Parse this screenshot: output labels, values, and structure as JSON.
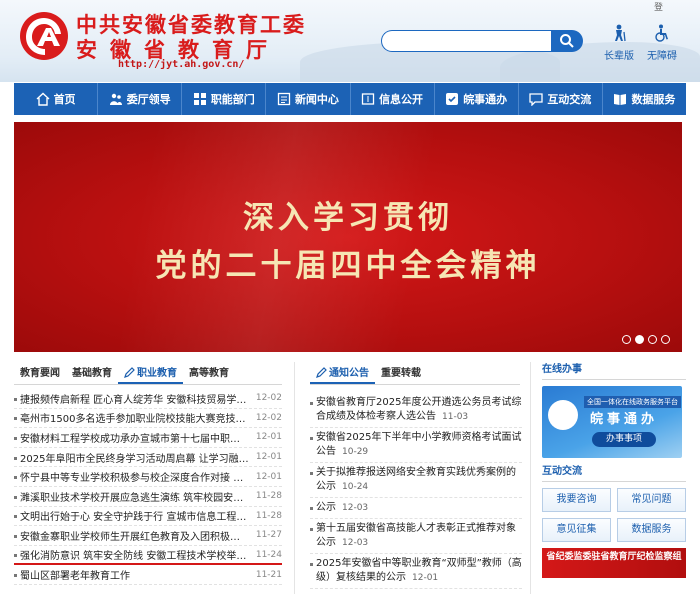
{
  "header": {
    "title_line1": "中共安徽省委教育工委",
    "title_line2": "安徽省教育厅",
    "url": "http://jyt.ah.gov.cn/",
    "search": {
      "value": "",
      "placeholder": ""
    },
    "accessibility": [
      {
        "label": "长辈版",
        "icon": "elder-person-icon"
      },
      {
        "label": "无障碍",
        "icon": "wheelchair-icon"
      }
    ],
    "top_strip_text": "登"
  },
  "nav": {
    "items": [
      {
        "label": "首页",
        "icon": "home-icon"
      },
      {
        "label": "委厅领导",
        "icon": "leader-icon"
      },
      {
        "label": "职能部门",
        "icon": "department-icon"
      },
      {
        "label": "新闻中心",
        "icon": "news-icon"
      },
      {
        "label": "信息公开",
        "icon": "info-icon"
      },
      {
        "label": "皖事通办",
        "icon": "service-icon"
      },
      {
        "label": "互动交流",
        "icon": "chat-icon"
      },
      {
        "label": "数据服务",
        "icon": "book-icon"
      }
    ]
  },
  "banner": {
    "line1": "深入学习贯彻",
    "line2": "党的二十届四中全会精神",
    "slides": 4,
    "active_slide": 2,
    "colors": {
      "bg": "#c31212",
      "text": "#f6e6b4"
    }
  },
  "left_panel": {
    "tabs": [
      "教育要闻",
      "基础教育",
      "职业教育",
      "高等教育"
    ],
    "active_tab": 2,
    "items": [
      {
        "title": "捷报频传启新程 匠心育人绽芳华 安徽科技贸易学校...",
        "date": "12-02"
      },
      {
        "title": "亳州市1500多名选手参加职业院校技能大赛竞技展...",
        "date": "12-02"
      },
      {
        "title": "安徽材料工程学校成功承办宣城市第十七届中职学校...",
        "date": "12-01"
      },
      {
        "title": "2025年阜阳市全民终身学习活动周启幕 让学习融入...",
        "date": "12-01"
      },
      {
        "title": "怀宁县中等专业学校积极参与校企深度合作对接 推进...",
        "date": "12-01"
      },
      {
        "title": "濉溪职业技术学校开展应急逃生演练 筑牢校园安全防...",
        "date": "11-28"
      },
      {
        "title": "文明出行始于心 安全守护践于行 宣城市信息工程学...",
        "date": "11-28"
      },
      {
        "title": "安徽金寨职业学校师生开展红色教育及入团积极分子...",
        "date": "11-27"
      },
      {
        "title": "强化消防意识 筑牢安全防线 安徽工程技术学校举行...",
        "date": "11-24"
      },
      {
        "title": "蜀山区部署老年教育工作",
        "date": "11-21"
      }
    ],
    "highlight_index": 8
  },
  "mid_panel": {
    "tabs": [
      "通知公告",
      "重要转载"
    ],
    "active_tab": 0,
    "items": [
      {
        "title": "安徽省教育厅2025年度公开遴选公务员考试综合成绩及体检考察人选公告",
        "date": "11-03"
      },
      {
        "title": "安徽省2025年下半年中小学教师资格考试面试公告",
        "date": "10-29"
      },
      {
        "title": "关于拟推荐报送网络安全教育实践优秀案例的公示",
        "date": "10-24"
      },
      {
        "title": "公示",
        "date": "12-03"
      },
      {
        "title": "第十五届安徽省高技能人才表彰正式推荐对象公示",
        "date": "12-03"
      },
      {
        "title": "2025年安徽省中等职业教育“双师型”教师（高级）复核结果的公示",
        "date": "12-01"
      }
    ]
  },
  "right_panel": {
    "online_title": "在线办事",
    "banshi": {
      "small": "全国一体化在线政务服务平台",
      "big": "皖事通办",
      "button": "办事事项"
    },
    "interact_title": "互动交流",
    "buttons": [
      "我要咨询",
      "常见问题",
      "意见征集",
      "数据服务"
    ],
    "jiwei": "省纪委监委驻省教育厅纪检监察组"
  },
  "colors": {
    "nav": "#1c62b5",
    "brand_red": "#d91c1c",
    "link_blue": "#1c5fae"
  }
}
